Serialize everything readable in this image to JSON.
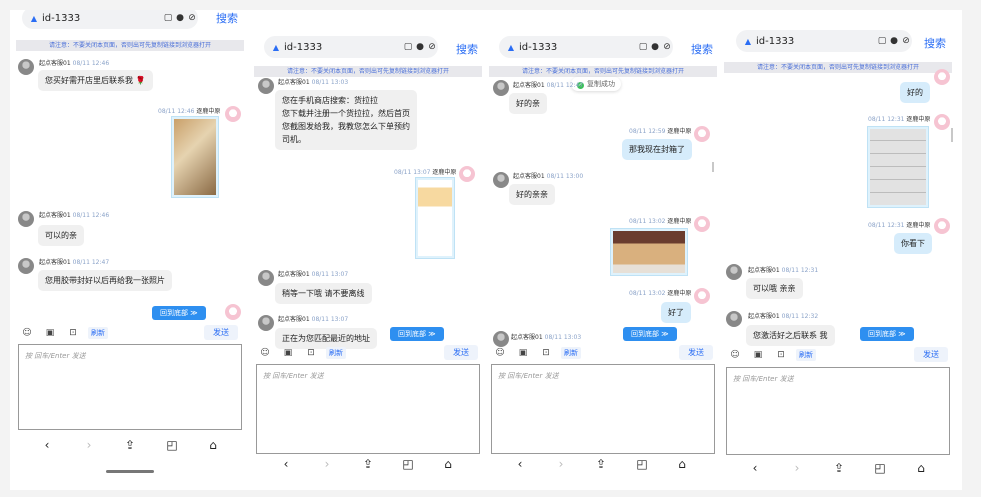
{
  "common": {
    "url": "id-1333",
    "search_label": "搜索",
    "notice": "请注意：不要关闭本页面，否则出可先复制链接到浏览器打开",
    "notice_short": "请注意：不要关闭本页面，否则出可先复制链接到浏览器打开",
    "agent_name": "起点客服01",
    "customer_name": "逐鹿中原",
    "scroll_bottom": "回到底部 ≫",
    "refresh": "刷新",
    "send": "发送",
    "input_placeholder": "按 回车/Enter 发送",
    "icons": [
      "emoji-icon",
      "image-icon",
      "file-icon"
    ],
    "nav_icons": [
      "back-icon",
      "forward-icon",
      "share-icon",
      "tabs-icon",
      "home-icon"
    ],
    "colors": {
      "accent": "#2a6df4",
      "scroll_button": "#2e8ff0",
      "agent_bubble": "#f0f0f0",
      "customer_bubble": "#d6ecfb"
    }
  },
  "phone1": {
    "m1": {
      "time": "08/11 12:46",
      "text": "您买好需开店里后联系我 🌹"
    },
    "m2": {
      "time": "08/11 12:46"
    },
    "m3": {
      "time": "08/11 12:46",
      "text": "可以的亲"
    },
    "m4": {
      "time": "08/11 12:47",
      "text": "您用胶带封好以后再给我一张照片"
    }
  },
  "phone2": {
    "m1": {
      "time": "08/11 13:03",
      "line1": "您在手机商店搜索：货拉拉",
      "line2": "您下载并注册一个货拉拉，然后首页",
      "line3": "您截图发给我，我教您怎么下单预约",
      "line4": "司机。"
    },
    "m2": {
      "time": "08/11 13:07"
    },
    "m3": {
      "time": "08/11 13:07",
      "text": "稍等一下哦 请不要离线"
    },
    "m4": {
      "time": "08/11 13:07",
      "text": "正在为您匹配最近的地址"
    }
  },
  "phone3": {
    "toast": "复制成功",
    "m1": {
      "time": "08/11 12:47",
      "text": "好的亲"
    },
    "m2": {
      "time": "08/11 12:59",
      "text": "那我现在封箱了"
    },
    "m3": {
      "time": "08/11 13:00",
      "text": "好的亲亲"
    },
    "m4": {
      "time": "08/11 13:02"
    },
    "m5": {
      "time": "08/11 13:02",
      "text": "好了"
    },
    "m6": {
      "time": "08/11 13:03"
    }
  },
  "phone4": {
    "m1": {
      "text": "好的"
    },
    "m2": {
      "time": "08/11 12:31"
    },
    "m3": {
      "time": "08/11 12:31",
      "text": "你看下"
    },
    "m4": {
      "time": "08/11 12:31",
      "text": "可以哦 亲亲"
    },
    "m5": {
      "time": "08/11 12:32",
      "text": "您激活好之后联系 我"
    }
  }
}
